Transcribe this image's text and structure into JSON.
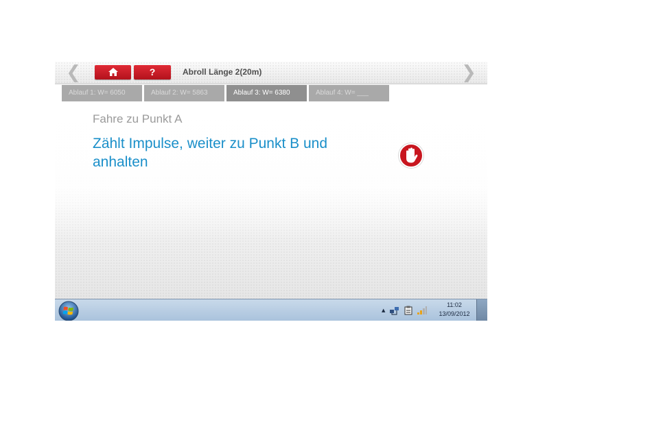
{
  "toolbar": {
    "prev_arrow": "❮",
    "next_arrow": "❯",
    "home_icon": "home-icon",
    "help_label": "?",
    "title": "Abroll Länge 2(20m)"
  },
  "tabs": [
    {
      "label": "Ablauf 1: W= 6050",
      "active": false
    },
    {
      "label": "Ablauf 2: W= 5863",
      "active": false
    },
    {
      "label": "Ablauf 3: W= 6380",
      "active": true
    },
    {
      "label": "Ablauf 4: W= ___",
      "active": false
    }
  ],
  "main": {
    "step_label": "Fahre zu Punkt A",
    "instruction": "Zählt Impulse, weiter zu Punkt B und anhalten",
    "stop_icon": "stop-hand-icon"
  },
  "taskbar": {
    "start_icon": "windows-start-icon",
    "tray": {
      "show_hidden": "▲",
      "icons": [
        "network-icon",
        "clipboard-icon",
        "signal-icon"
      ]
    },
    "time": "11:02",
    "date": "13/09/2012"
  },
  "colors": {
    "accent_red": "#c8161f",
    "instruction_blue": "#1a8fc9",
    "tab_gray": "#a9a9a9",
    "tab_active": "#8f8f8f"
  }
}
